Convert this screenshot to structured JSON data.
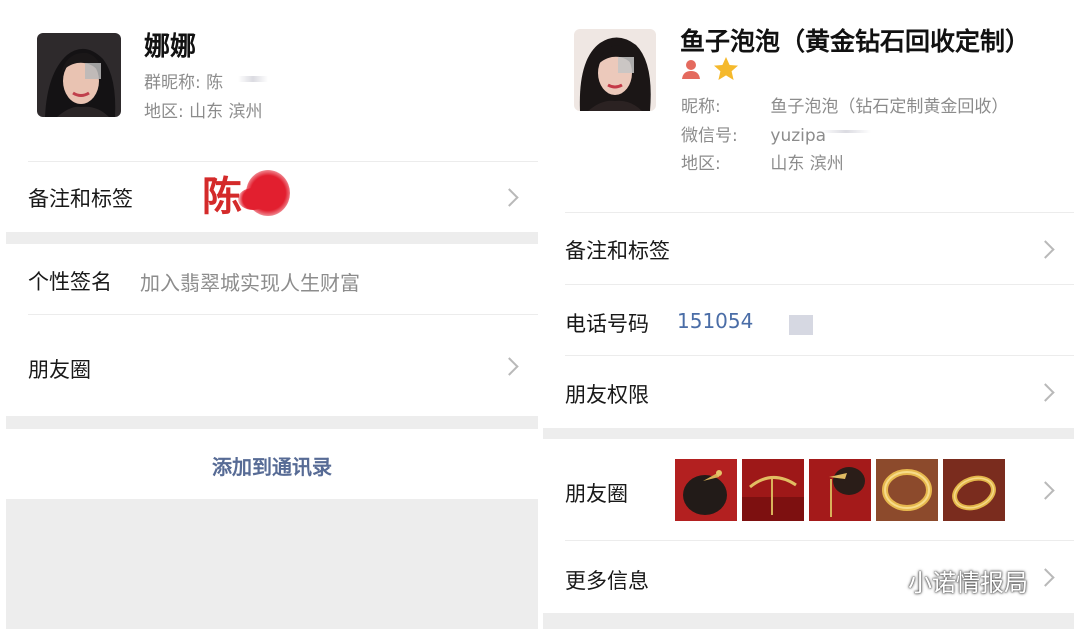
{
  "left": {
    "name": "娜娜",
    "group_nick_label": "群昵称:",
    "group_nick_value": "陈",
    "region_label": "地区:",
    "region_value": "山东 滨州",
    "remark_label": "备注和标签",
    "remark_handwritten": "陈",
    "signature_label": "个性签名",
    "signature_value": "加入翡翠城实现人生财富",
    "moments_label": "朋友圈",
    "add_contact": "添加到通讯录"
  },
  "right": {
    "name": "鱼子泡泡（黄金钻石回收定制）",
    "nickname_label": "昵称:",
    "nickname_value": "鱼子泡泡（钻石定制黄金回收）",
    "wechat_label": "微信号:",
    "wechat_value": "yuzipa",
    "region_label": "地区:",
    "region_value": "山东 滨州",
    "remark_label": "备注和标签",
    "phone_label": "电话号码",
    "phone_value": "151054",
    "permission_label": "朋友权限",
    "moments_label": "朋友圈",
    "more_label": "更多信息"
  },
  "watermark": "小诺情报局",
  "colors": {
    "link_blue": "#576b95",
    "phone_blue": "#4a6da7",
    "annotation_red": "#d42a2a",
    "star_gold": "#f5b92c",
    "gap_gray": "#ededed"
  },
  "icons": [
    "person-icon",
    "star-icon",
    "chevron-right-icon",
    "wechat-logo-icon"
  ]
}
